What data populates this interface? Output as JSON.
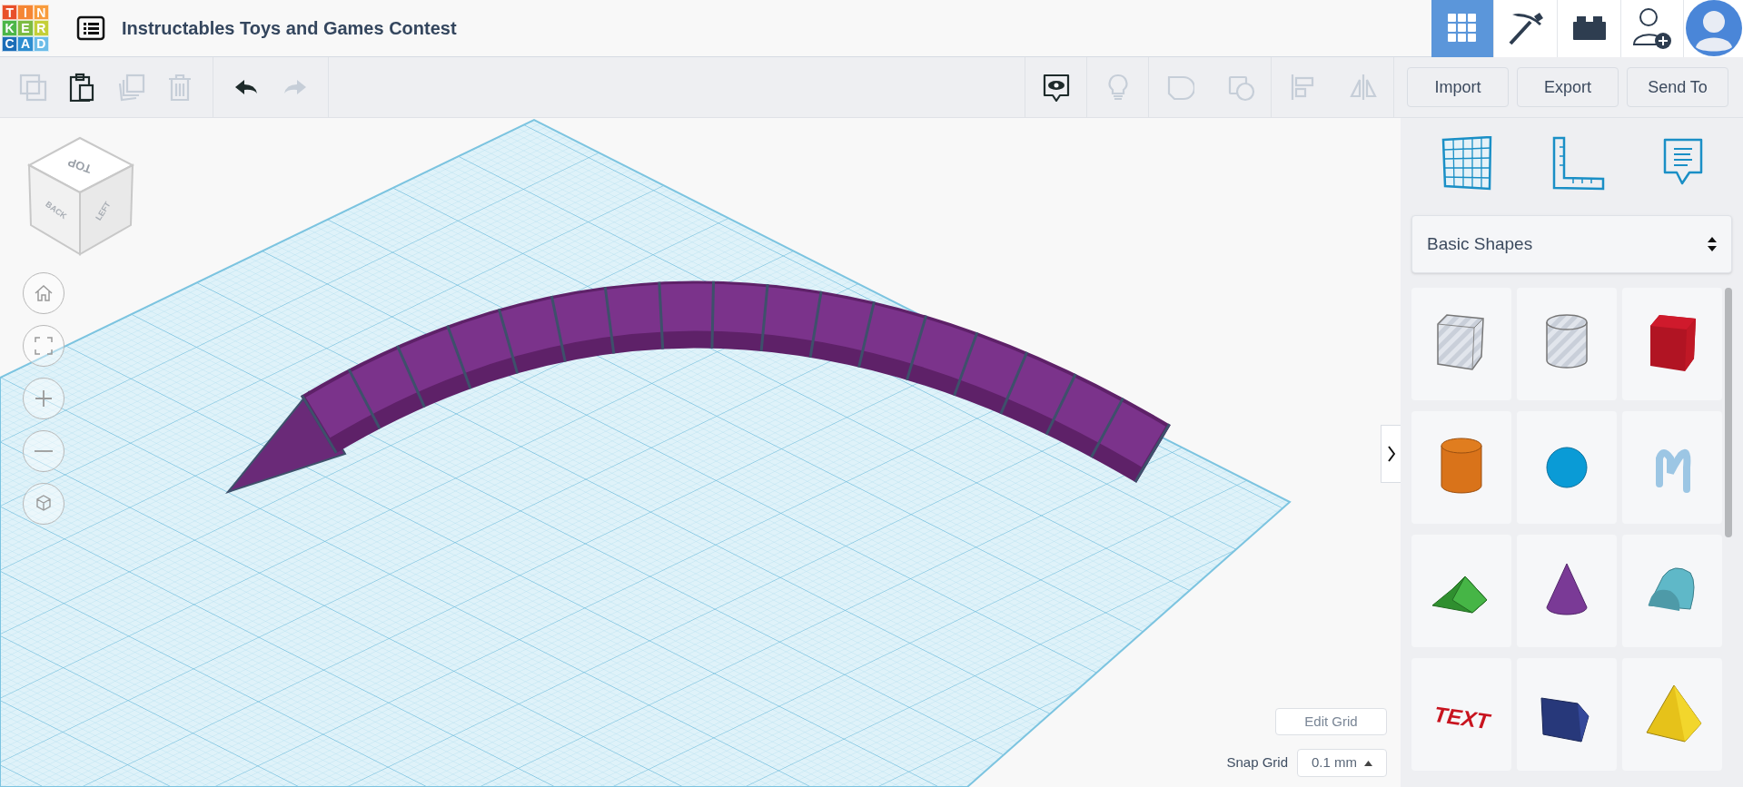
{
  "logo": [
    {
      "letter": "T",
      "color": "#e8502a"
    },
    {
      "letter": "I",
      "color": "#f58634"
    },
    {
      "letter": "N",
      "color": "#f89b3c"
    },
    {
      "letter": "K",
      "color": "#4cb648"
    },
    {
      "letter": "E",
      "color": "#7cbb42"
    },
    {
      "letter": "R",
      "color": "#c4cf38"
    },
    {
      "letter": "C",
      "color": "#1b6db7"
    },
    {
      "letter": "A",
      "color": "#2d8dd0"
    },
    {
      "letter": "D",
      "color": "#6cbce8"
    }
  ],
  "design_title": "Instructables Toys and Games Contest",
  "view_modes": [
    {
      "kind": "grid",
      "selected": true
    },
    {
      "kind": "pickaxe",
      "selected": false
    },
    {
      "kind": "bricks",
      "selected": false
    }
  ],
  "edit_tools": [
    {
      "kind": "copy",
      "disabled": true
    },
    {
      "kind": "paste",
      "disabled": false
    },
    {
      "kind": "duplicate",
      "disabled": true
    },
    {
      "kind": "delete",
      "disabled": true
    },
    {
      "kind": "undo",
      "disabled": false
    },
    {
      "kind": "redo",
      "disabled": true
    }
  ],
  "view_tools": [
    {
      "kind": "notes",
      "disabled": false
    },
    {
      "kind": "bulb",
      "disabled": true
    },
    {
      "kind": "group",
      "disabled": true
    },
    {
      "kind": "ungroup",
      "disabled": true
    },
    {
      "kind": "align",
      "disabled": true
    },
    {
      "kind": "mirror",
      "disabled": true
    }
  ],
  "actions": [
    "Import",
    "Export",
    "Send To"
  ],
  "view_cube": {
    "top": "TOP",
    "front": "BACK",
    "side": "LEFT"
  },
  "library": {
    "value": "Basic Shapes"
  },
  "shapes": [
    {
      "kind": "box-hole"
    },
    {
      "kind": "cylinder-hole"
    },
    {
      "kind": "box"
    },
    {
      "kind": "cylinder"
    },
    {
      "kind": "sphere"
    },
    {
      "kind": "scribble"
    },
    {
      "kind": "roof"
    },
    {
      "kind": "cone"
    },
    {
      "kind": "round-roof"
    },
    {
      "kind": "text",
      "label": "TEXT"
    },
    {
      "kind": "wedge"
    },
    {
      "kind": "pyramid"
    }
  ],
  "grid": {
    "edit_button": "Edit Grid",
    "snap_label": "Snap Grid",
    "snap_value": "0.1 mm"
  }
}
